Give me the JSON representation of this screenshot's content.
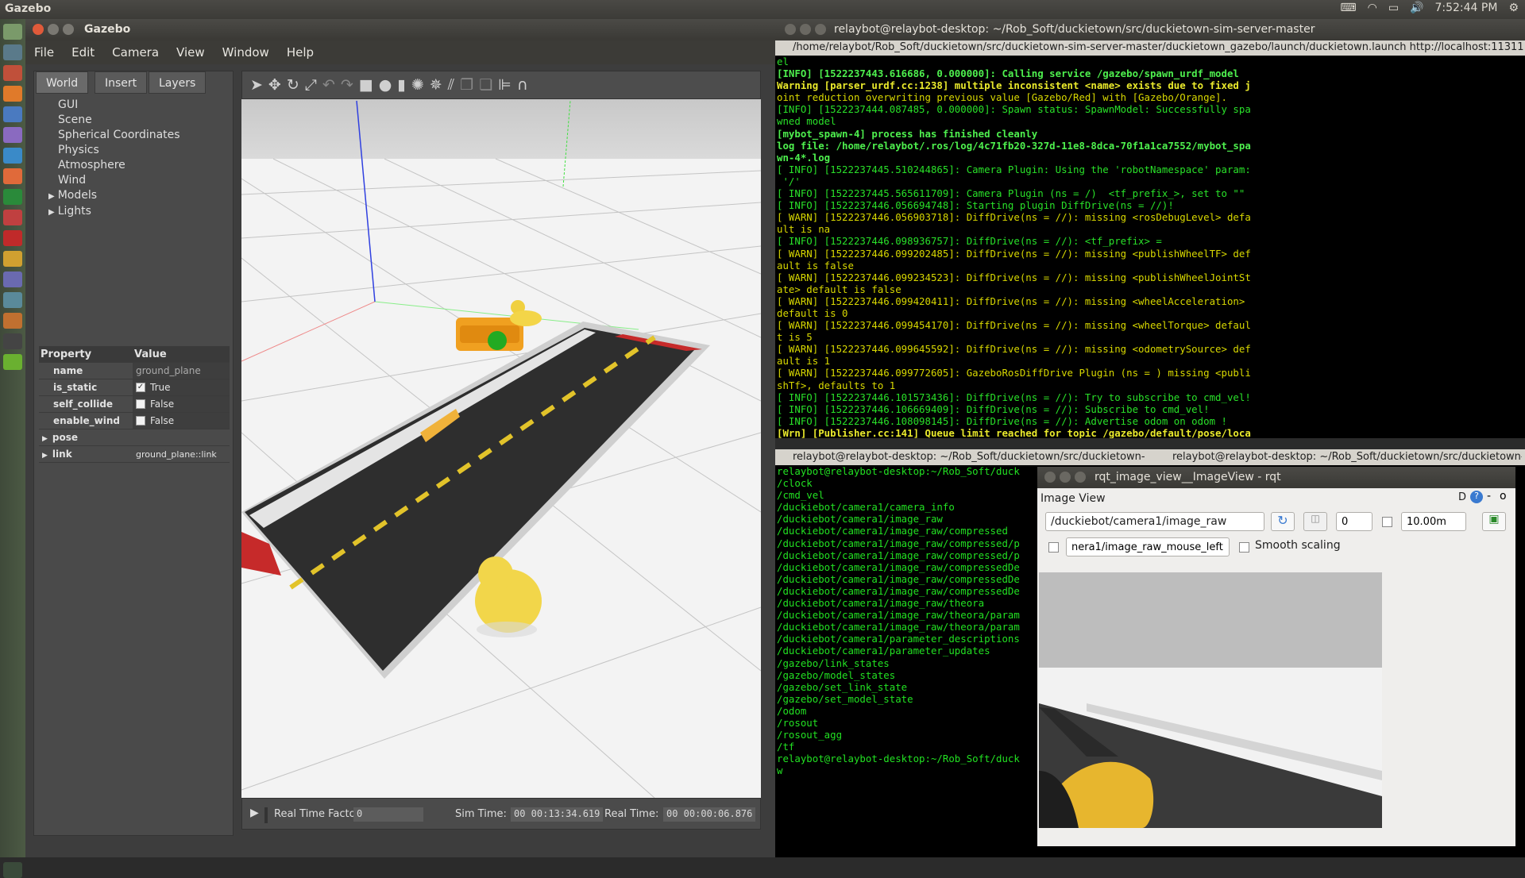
{
  "topbar": {
    "app_name": "Gazebo",
    "clock": "7:52:44 PM"
  },
  "gazebo": {
    "window_title": "Gazebo",
    "menu": [
      "File",
      "Edit",
      "Camera",
      "View",
      "Window",
      "Help"
    ],
    "tabs": [
      "World",
      "Insert",
      "Layers"
    ],
    "tree": [
      "GUI",
      "Scene",
      "Spherical Coordinates",
      "Physics",
      "Atmosphere",
      "Wind"
    ],
    "tree_expandable": [
      "Models",
      "Lights"
    ],
    "props_header": {
      "property": "Property",
      "value": "Value"
    },
    "props": {
      "name_k": "name",
      "name_v": "ground_plane",
      "static_k": "is_static",
      "static_v": "True",
      "collide_k": "self_collide",
      "collide_v": "False",
      "wind_k": "enable_wind",
      "wind_v": "False",
      "pose_k": "pose",
      "link_k": "link",
      "link_v": "ground_plane::link"
    },
    "status": {
      "rtf_label": "Real Time Factor:",
      "rtf_value": "0",
      "sim_label": "Sim Time:",
      "sim_value": "00 00:13:34.619",
      "real_label": "Real Time:",
      "real_value": "00 00:00:06.876"
    }
  },
  "terminal1": {
    "title": "relaybot@relaybot-desktop: ~/Rob_Soft/duckietown/src/duckietown-sim-server-master",
    "tab": "/home/relaybot/Rob_Soft/duckietown/src/duckietown-sim-server-master/duckietown_gazebo/launch/duckietown.launch http://localhost:11311",
    "lines": [
      {
        "t": "el",
        "c": "g"
      },
      {
        "t": "[INFO] [1522237443.616686, 0.000000]: Calling service /gazebo/spawn_urdf_model",
        "c": "gb"
      },
      {
        "t": "Warning [parser_urdf.cc:1238] multiple inconsistent <name> exists due to fixed j",
        "c": "yb"
      },
      {
        "t": "oint reduction overwriting previous value [Gazebo/Red] with [Gazebo/Orange].",
        "c": "y"
      },
      {
        "t": "[INFO] [1522237444.087485, 0.000000]: Spawn status: SpawnModel: Successfully spa",
        "c": "g"
      },
      {
        "t": "wned model",
        "c": "g"
      },
      {
        "t": "[mybot_spawn-4] process has finished cleanly",
        "c": "gb"
      },
      {
        "t": "log file: /home/relaybot/.ros/log/4c71fb20-327d-11e8-8dca-70f1a1ca7552/mybot_spa",
        "c": "gb"
      },
      {
        "t": "wn-4*.log",
        "c": "gb"
      },
      {
        "t": "[ INFO] [1522237445.510244865]: Camera Plugin: Using the 'robotNamespace' param:",
        "c": "g"
      },
      {
        "t": " '/'",
        "c": "g"
      },
      {
        "t": "[ INFO] [1522237445.565611709]: Camera Plugin (ns = /)  <tf_prefix_>, set to \"\"",
        "c": "g"
      },
      {
        "t": "[ INFO] [1522237446.056694748]: Starting plugin DiffDrive(ns = //)!",
        "c": "g"
      },
      {
        "t": "[ WARN] [1522237446.056903718]: DiffDrive(ns = //): missing <rosDebugLevel> defa",
        "c": "y"
      },
      {
        "t": "ult is na",
        "c": "y"
      },
      {
        "t": "[ INFO] [1522237446.098936757]: DiffDrive(ns = //): <tf_prefix> =",
        "c": "g"
      },
      {
        "t": "[ WARN] [1522237446.099202485]: DiffDrive(ns = //): missing <publishWheelTF> def",
        "c": "y"
      },
      {
        "t": "ault is false",
        "c": "y"
      },
      {
        "t": "[ WARN] [1522237446.099234523]: DiffDrive(ns = //): missing <publishWheelJointSt",
        "c": "y"
      },
      {
        "t": "ate> default is false",
        "c": "y"
      },
      {
        "t": "[ WARN] [1522237446.099420411]: DiffDrive(ns = //): missing <wheelAcceleration>",
        "c": "y"
      },
      {
        "t": "default is 0",
        "c": "y"
      },
      {
        "t": "[ WARN] [1522237446.099454170]: DiffDrive(ns = //): missing <wheelTorque> defaul",
        "c": "y"
      },
      {
        "t": "t is 5",
        "c": "y"
      },
      {
        "t": "[ WARN] [1522237446.099645592]: DiffDrive(ns = //): missing <odometrySource> def",
        "c": "y"
      },
      {
        "t": "ault is 1",
        "c": "y"
      },
      {
        "t": "[ WARN] [1522237446.099772605]: GazeboRosDiffDrive Plugin (ns = ) missing <publi",
        "c": "y"
      },
      {
        "t": "shTf>, defaults to 1",
        "c": "y"
      },
      {
        "t": "[ INFO] [1522237446.101573436]: DiffDrive(ns = //): Try to subscribe to cmd_vel!",
        "c": "g"
      },
      {
        "t": "[ INFO] [1522237446.106669409]: DiffDrive(ns = //): Subscribe to cmd_vel!",
        "c": "g"
      },
      {
        "t": "[ INFO] [1522237446.108098145]: DiffDrive(ns = //): Advertise odom on odom !",
        "c": "g"
      },
      {
        "t": "[Wrn] [Publisher.cc:141] Queue limit reached for topic /gazebo/default/pose/loca",
        "c": "yb"
      }
    ]
  },
  "terminal2": {
    "tab1": "relaybot@relaybot-desktop: ~/Rob_Soft/duckietown/src/duckietown-",
    "tab2": "relaybot@relaybot-desktop: ~/Rob_Soft/duckietown/src/duckietown-",
    "lines": [
      "relaybot@relaybot-desktop:~/Rob_Soft/duck",
      "/clock",
      "/cmd_vel",
      "/duckiebot/camera1/camera_info",
      "/duckiebot/camera1/image_raw",
      "/duckiebot/camera1/image_raw/compressed",
      "/duckiebot/camera1/image_raw/compressed/p",
      "/duckiebot/camera1/image_raw/compressed/p",
      "/duckiebot/camera1/image_raw/compressedDe",
      "/duckiebot/camera1/image_raw/compressedDe",
      "/duckiebot/camera1/image_raw/compressedDe",
      "/duckiebot/camera1/image_raw/theora",
      "/duckiebot/camera1/image_raw/theora/param",
      "/duckiebot/camera1/image_raw/theora/param",
      "/duckiebot/camera1/parameter_descriptions",
      "/duckiebot/camera1/parameter_updates",
      "/gazebo/link_states",
      "/gazebo/model_states",
      "/gazebo/set_link_state",
      "/gazebo/set_model_state",
      "/odom",
      "/rosout",
      "/rosout_agg",
      "/tf",
      "relaybot@relaybot-desktop:~/Rob_Soft/duck",
      "w"
    ]
  },
  "rqt": {
    "title": "rqt_image_view__ImageView - rqt",
    "panel_title": "Image View",
    "panel_controls": "D",
    "topic": "/duckiebot/camera1/image_raw",
    "spin_value": "0",
    "max_range": "10.00m",
    "mouse_topic": "nera1/image_raw_mouse_left",
    "smooth_label": "Smooth scaling"
  }
}
